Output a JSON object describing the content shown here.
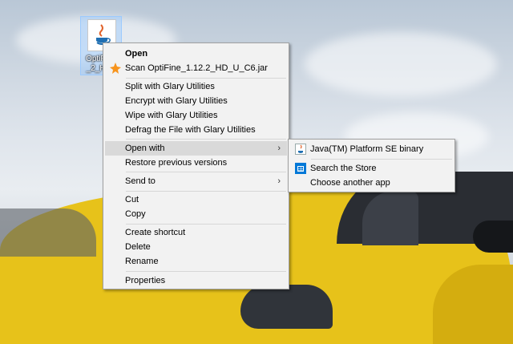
{
  "desktop": {
    "icon_label": "OptiFine\n_2_HD_"
  },
  "context_menu": {
    "items": [
      {
        "label": "Open"
      },
      {
        "label": "Scan OptiFine_1.12.2_HD_U_C6.jar",
        "icon": "avast-icon"
      },
      {
        "label": "Split with Glary Utilities"
      },
      {
        "label": "Encrypt with Glary Utilities"
      },
      {
        "label": "Wipe with Glary Utilities"
      },
      {
        "label": "Defrag the File with Glary Utilities"
      },
      {
        "label": "Open with"
      },
      {
        "label": "Restore previous versions"
      },
      {
        "label": "Send to"
      },
      {
        "label": "Cut"
      },
      {
        "label": "Copy"
      },
      {
        "label": "Create shortcut"
      },
      {
        "label": "Delete"
      },
      {
        "label": "Rename"
      },
      {
        "label": "Properties"
      }
    ],
    "submenu_arrow": "›"
  },
  "open_with_submenu": {
    "items": [
      {
        "label": "Java(TM) Platform SE binary",
        "icon": "java-icon"
      },
      {
        "label": "Search the Store",
        "icon": "store-icon"
      },
      {
        "label": "Choose another app"
      }
    ]
  },
  "colors": {
    "menu_bg": "#f2f2f2",
    "highlight": "#d9d9d9",
    "car_yellow": "#e7c21a",
    "avast_orange": "#f7941d",
    "store_blue": "#0078d7"
  }
}
